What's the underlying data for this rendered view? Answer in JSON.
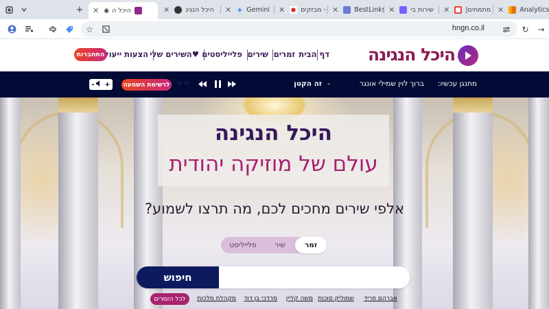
{
  "browser": {
    "tabs": [
      {
        "title": "Analytics",
        "favicon_color": "#f9ab00"
      },
      {
        "title": "|מתמחים",
        "favicon_color": "#ea4335"
      },
      {
        "title": "שירות בי",
        "favicon_color": "#7b61ff"
      },
      {
        "title": "BestLinks",
        "favicon_color": "#6b7bd8"
      },
      {
        "title": "מבזקים -",
        "favicon_color": "#d93025"
      },
      {
        "title": "Gemini",
        "favicon_color": "#4e8cf5"
      },
      {
        "title": "היכל הנגינ",
        "favicon_color": "#333333"
      },
      {
        "title": "היכל ה",
        "favicon_color": "#8e2a8b",
        "active": true
      }
    ],
    "url": "hngn.co.il"
  },
  "site": {
    "logo_text": "היכל הנגינה",
    "nav": {
      "home": "דף הבית",
      "singers": "זמרים",
      "songs": "שירים",
      "playlists": "פלייליסטים",
      "my_songs": "♥השירים שלי",
      "suggestions": "הצעות ייעול",
      "login": "התחברות"
    }
  },
  "player": {
    "now_playing_label": "מתנגן עכשיו:",
    "artist": "ברוך לוין שמילי אונגר",
    "separator": "-",
    "song": "זה הקטן",
    "listen_list": "לרשימת השמעה",
    "time": ":: ::",
    "volume_minus": "-",
    "volume_plus": "+"
  },
  "hero": {
    "title": "היכל הנגינה",
    "subtitle": "עולם של מוזיקה יהודית",
    "prompt": "אלפי שירים מחכים לכם, מה תרצו לשמוע?",
    "search_types": [
      "זמר",
      "שיר",
      "פלייליסט"
    ],
    "active_search_type": "זמר",
    "search_button": "חיפוש",
    "search_placeholder": "",
    "all_singers": "לכל הזמרים",
    "popular_artists": [
      "אברהם פריד",
      "שמוליק סוכות",
      "משה קליין",
      "מרדכי בן דוד",
      "מקהלת מלכות"
    ]
  },
  "colors": {
    "brand_purple": "#36185c",
    "brand_magenta": "#a52070",
    "player_bg": "#020a36",
    "search_button_bg": "#0d1b5e"
  }
}
